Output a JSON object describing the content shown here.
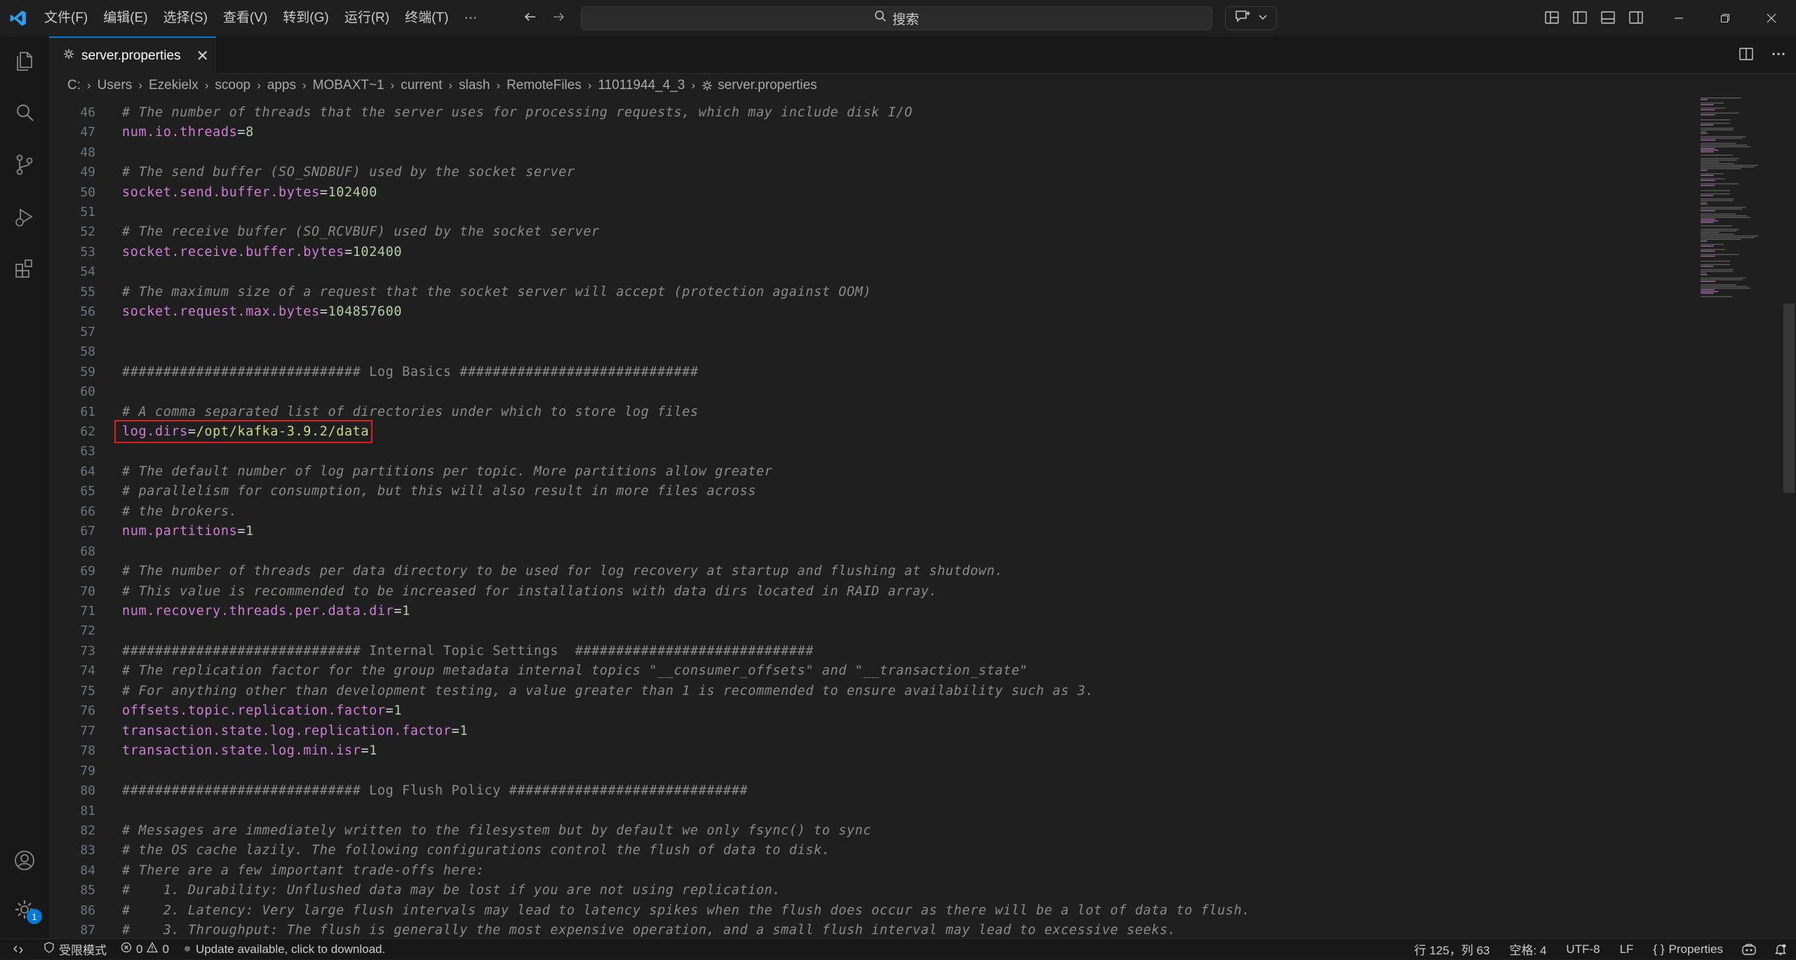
{
  "menu": [
    "文件(F)",
    "编辑(E)",
    "选择(S)",
    "查看(V)",
    "转到(G)",
    "运行(R)",
    "终端(T)",
    "···"
  ],
  "search": {
    "placeholder": "搜索"
  },
  "tab": {
    "label": "server.properties",
    "close": "✕"
  },
  "breadcrumb": [
    "C:",
    "Users",
    "Ezekielx",
    "scoop",
    "apps",
    "MOBAXT~1",
    "current",
    "slash",
    "RemoteFiles",
    "11011944_4_3",
    "server.properties"
  ],
  "lines": [
    {
      "n": "46",
      "type": "comment",
      "text": "# The number of threads that the server uses for processing requests, which may include disk I/O"
    },
    {
      "n": "47",
      "type": "prop",
      "key": "num.io.threads",
      "value": "8"
    },
    {
      "n": "48",
      "type": "blank",
      "text": ""
    },
    {
      "n": "49",
      "type": "comment",
      "text": "# The send buffer (SO_SNDBUF) used by the socket server"
    },
    {
      "n": "50",
      "type": "prop",
      "key": "socket.send.buffer.bytes",
      "value": "102400"
    },
    {
      "n": "51",
      "type": "blank",
      "text": ""
    },
    {
      "n": "52",
      "type": "comment",
      "text": "# The receive buffer (SO_RCVBUF) used by the socket server"
    },
    {
      "n": "53",
      "type": "prop",
      "key": "socket.receive.buffer.bytes",
      "value": "102400"
    },
    {
      "n": "54",
      "type": "blank",
      "text": ""
    },
    {
      "n": "55",
      "type": "comment",
      "text": "# The maximum size of a request that the socket server will accept (protection against OOM)"
    },
    {
      "n": "56",
      "type": "prop",
      "key": "socket.request.max.bytes",
      "value": "104857600"
    },
    {
      "n": "57",
      "type": "blank",
      "text": ""
    },
    {
      "n": "58",
      "type": "blank",
      "text": ""
    },
    {
      "n": "59",
      "type": "hash",
      "text": "############################# Log Basics #############################"
    },
    {
      "n": "60",
      "type": "blank",
      "text": ""
    },
    {
      "n": "61",
      "type": "comment",
      "text": "# A comma separated list of directories under which to store log files"
    },
    {
      "n": "62",
      "type": "prop",
      "key": "log.dirs",
      "value": "/opt/kafka-3.9.2/data"
    },
    {
      "n": "63",
      "type": "blank",
      "text": ""
    },
    {
      "n": "64",
      "type": "comment",
      "text": "# The default number of log partitions per topic. More partitions allow greater"
    },
    {
      "n": "65",
      "type": "comment",
      "text": "# parallelism for consumption, but this will also result in more files across"
    },
    {
      "n": "66",
      "type": "comment",
      "text": "# the brokers."
    },
    {
      "n": "67",
      "type": "prop",
      "key": "num.partitions",
      "value": "1"
    },
    {
      "n": "68",
      "type": "blank",
      "text": ""
    },
    {
      "n": "69",
      "type": "comment",
      "text": "# The number of threads per data directory to be used for log recovery at startup and flushing at shutdown."
    },
    {
      "n": "70",
      "type": "comment",
      "text": "# This value is recommended to be increased for installations with data dirs located in RAID array."
    },
    {
      "n": "71",
      "type": "prop",
      "key": "num.recovery.threads.per.data.dir",
      "value": "1"
    },
    {
      "n": "72",
      "type": "blank",
      "text": ""
    },
    {
      "n": "73",
      "type": "hash",
      "text": "############################# Internal Topic Settings  #############################"
    },
    {
      "n": "74",
      "type": "comment",
      "text": "# The replication factor for the group metadata internal topics \"__consumer_offsets\" and \"__transaction_state\""
    },
    {
      "n": "75",
      "type": "comment",
      "text": "# For anything other than development testing, a value greater than 1 is recommended to ensure availability such as 3."
    },
    {
      "n": "76",
      "type": "prop",
      "key": "offsets.topic.replication.factor",
      "value": "1"
    },
    {
      "n": "77",
      "type": "prop",
      "key": "transaction.state.log.replication.factor",
      "value": "1"
    },
    {
      "n": "78",
      "type": "prop",
      "key": "transaction.state.log.min.isr",
      "value": "1"
    },
    {
      "n": "79",
      "type": "blank",
      "text": ""
    },
    {
      "n": "80",
      "type": "hash",
      "text": "############################# Log Flush Policy #############################"
    },
    {
      "n": "81",
      "type": "blank",
      "text": ""
    },
    {
      "n": "82",
      "type": "comment",
      "text": "# Messages are immediately written to the filesystem but by default we only fsync() to sync"
    },
    {
      "n": "83",
      "type": "comment",
      "text": "# the OS cache lazily. The following configurations control the flush of data to disk."
    },
    {
      "n": "84",
      "type": "comment",
      "text": "# There are a few important trade-offs here:"
    },
    {
      "n": "85",
      "type": "comment",
      "text": "#    1. Durability: Unflushed data may be lost if you are not using replication."
    },
    {
      "n": "86",
      "type": "comment",
      "text": "#    2. Latency: Very large flush intervals may lead to latency spikes when the flush does occur as there will be a lot of data to flush."
    },
    {
      "n": "87",
      "type": "comment",
      "text": "#    3. Throughput: The flush is generally the most expensive operation, and a small flush interval may lead to excessive seeks."
    }
  ],
  "statusbar": {
    "restricted": "受限模式",
    "errors": "0",
    "warnings": "0",
    "update": "Update available, click to download.",
    "position": "行 125，列 63",
    "spaces": "空格: 4",
    "encoding": "UTF-8",
    "eol": "LF",
    "language": "Properties",
    "language_icon": "{ }"
  },
  "accounts_badge": "1",
  "colors": {
    "accent": "#0078d4",
    "highlight_box": "#e02020",
    "key": "#cf7fd6",
    "value": "#b5cea8"
  }
}
